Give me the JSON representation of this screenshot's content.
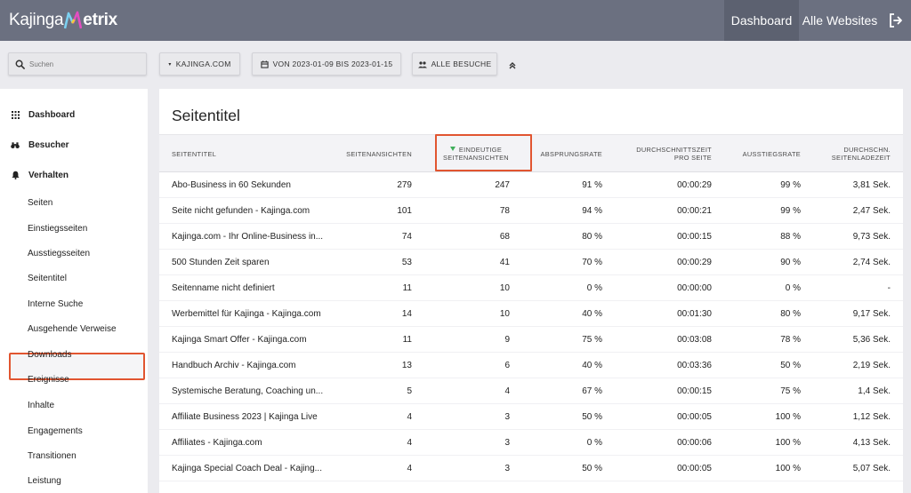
{
  "header": {
    "logo_left": "Kajinga",
    "logo_right": "etrix",
    "nav_dashboard": "Dashboard",
    "nav_all_websites": "Alle Websites",
    "logout_icon": "logout-icon"
  },
  "toolbar": {
    "search_placeholder": "Suchen",
    "site_label": "KAJINGA.COM",
    "date_range_label": "VON 2023-01-09 BIS 2023-01-15",
    "segment_label": "ALLE BESUCHE"
  },
  "sidebar": {
    "main_items": [
      {
        "label": "Dashboard",
        "icon": "grid-icon"
      },
      {
        "label": "Besucher",
        "icon": "binoculars-icon"
      },
      {
        "label": "Verhalten",
        "icon": "bell-icon"
      }
    ],
    "sub_items": [
      "Seiten",
      "Einstiegsseiten",
      "Ausstiegsseiten",
      "Seitentitel",
      "Interne Suche",
      "Ausgehende Verweise",
      "Downloads",
      "Ereignisse",
      "Inhalte",
      "Engagements",
      "Transitionen",
      "Leistung"
    ],
    "active_item": "Seitentitel"
  },
  "report": {
    "title": "Seitentitel",
    "columns": {
      "title": "SEITENTITEL",
      "views": "SEITENANSICHTEN",
      "unique_1": "EINDEUTIGE",
      "unique_2": "SEITENANSICHTEN",
      "bounce": "ABSPRUNGSRATE",
      "time_1": "DURCHSCHNITTSZEIT",
      "time_2": "PRO SEITE",
      "exit": "AUSSTIEGSRATE",
      "load_1": "DURCHSCHN.",
      "load_2": "SEITENLADEZEIT"
    },
    "sorted_column": "unique",
    "rows": [
      {
        "title": "Abo-Business in 60 Sekunden",
        "views": "279",
        "unique": "247",
        "bounce": "91 %",
        "time": "00:00:29",
        "exit": "99 %",
        "load": "3,81 Sek."
      },
      {
        "title": "Seite nicht gefunden - Kajinga.com",
        "views": "101",
        "unique": "78",
        "bounce": "94 %",
        "time": "00:00:21",
        "exit": "99 %",
        "load": "2,47 Sek."
      },
      {
        "title": "Kajinga.com - Ihr Online-Business in...",
        "views": "74",
        "unique": "68",
        "bounce": "80 %",
        "time": "00:00:15",
        "exit": "88 %",
        "load": "9,73 Sek."
      },
      {
        "title": "500 Stunden Zeit sparen",
        "views": "53",
        "unique": "41",
        "bounce": "70 %",
        "time": "00:00:29",
        "exit": "90 %",
        "load": "2,74 Sek."
      },
      {
        "title": "Seitenname nicht definiert",
        "views": "11",
        "unique": "10",
        "bounce": "0 %",
        "time": "00:00:00",
        "exit": "0 %",
        "load": "-"
      },
      {
        "title": "Werbemittel für Kajinga - Kajinga.com",
        "views": "14",
        "unique": "10",
        "bounce": "40 %",
        "time": "00:01:30",
        "exit": "80 %",
        "load": "9,17 Sek."
      },
      {
        "title": "Kajinga Smart Offer - Kajinga.com",
        "views": "11",
        "unique": "9",
        "bounce": "75 %",
        "time": "00:03:08",
        "exit": "78 %",
        "load": "5,36 Sek."
      },
      {
        "title": "Handbuch Archiv - Kajinga.com",
        "views": "13",
        "unique": "6",
        "bounce": "40 %",
        "time": "00:03:36",
        "exit": "50 %",
        "load": "2,19 Sek."
      },
      {
        "title": "Systemische Beratung, Coaching un...",
        "views": "5",
        "unique": "4",
        "bounce": "67 %",
        "time": "00:00:15",
        "exit": "75 %",
        "load": "1,4 Sek."
      },
      {
        "title": "Affiliate Business 2023 | Kajinga Live",
        "views": "4",
        "unique": "3",
        "bounce": "50 %",
        "time": "00:00:05",
        "exit": "100 %",
        "load": "1,12 Sek."
      },
      {
        "title": "Affiliates - Kajinga.com",
        "views": "4",
        "unique": "3",
        "bounce": "0 %",
        "time": "00:00:06",
        "exit": "100 %",
        "load": "4,13 Sek."
      },
      {
        "title": "Kajinga Special Coach Deal - Kajing...",
        "views": "4",
        "unique": "3",
        "bounce": "50 %",
        "time": "00:00:05",
        "exit": "100 %",
        "load": "5,07 Sek."
      }
    ]
  }
}
